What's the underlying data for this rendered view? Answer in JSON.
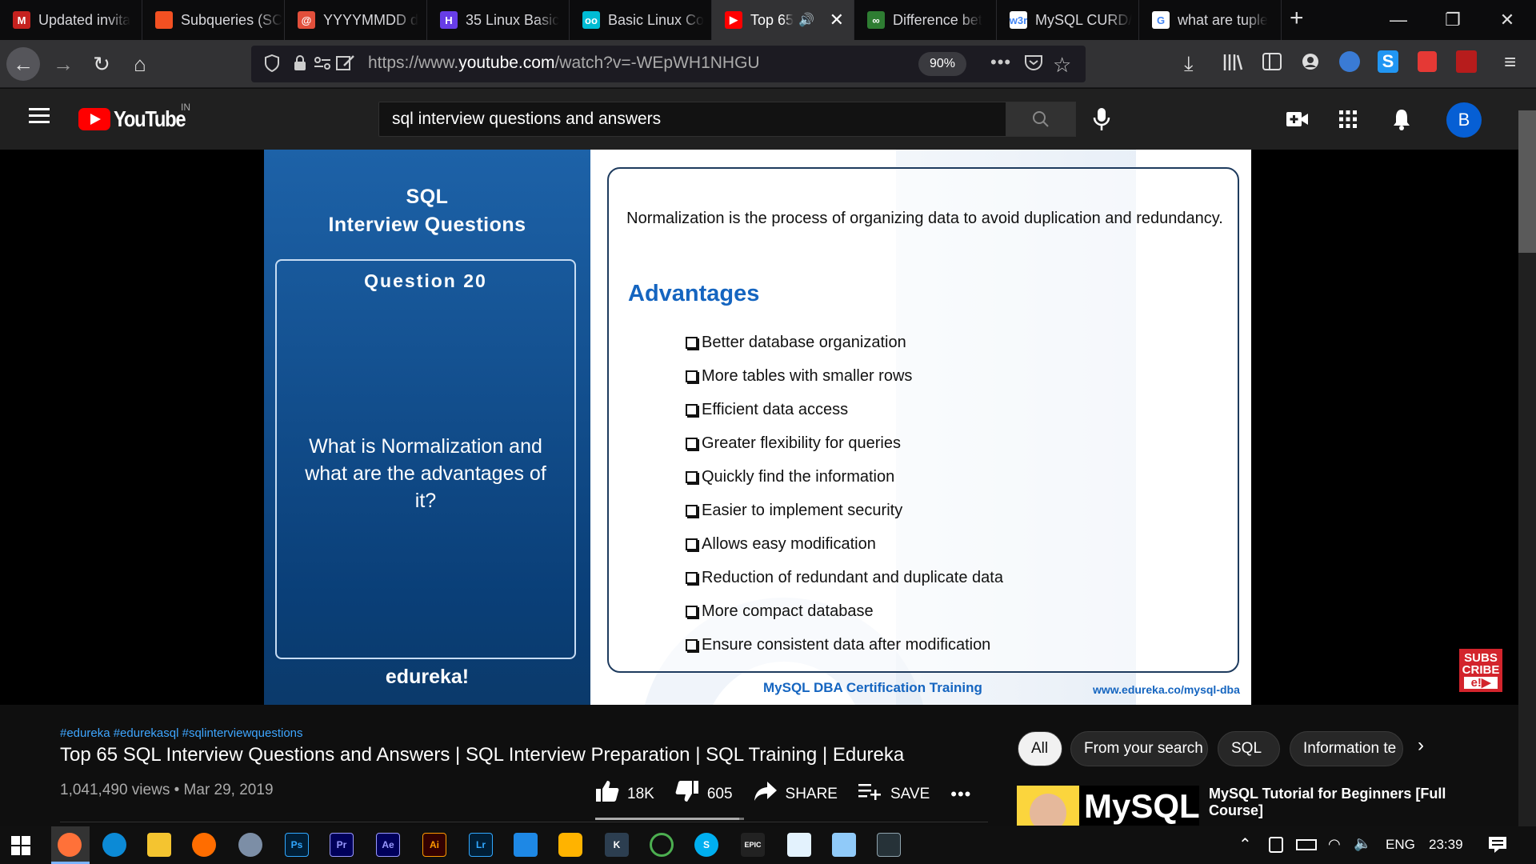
{
  "browser": {
    "tabs": [
      {
        "title": "Updated invita",
        "favicon": "gmail-icon",
        "color": "#c5221f",
        "glyph": "M"
      },
      {
        "title": "Subqueries (SC",
        "favicon": "microsoft-icon",
        "color": "#f25022",
        "glyph": ""
      },
      {
        "title": "YYYYMMDD d",
        "favicon": "red-circle-icon",
        "color": "#e24f3b",
        "glyph": "@"
      },
      {
        "title": "35 Linux Basic",
        "favicon": "hostinger-icon",
        "color": "#673de6",
        "glyph": "H"
      },
      {
        "title": "Basic Linux Co",
        "favicon": "goggles-icon",
        "color": "#00bcd4",
        "glyph": "oo"
      },
      {
        "title": "Top 65",
        "favicon": "youtube-icon",
        "color": "#ff0000",
        "glyph": "▶",
        "active": true,
        "audio": "🔊",
        "close": "✕"
      },
      {
        "title": "Difference bet",
        "favicon": "link-icon",
        "color": "#2e7d32",
        "glyph": "∞"
      },
      {
        "title": "MySQL CURD/",
        "favicon": "w3r-icon",
        "color": "#ffffff",
        "glyph": "w3r"
      },
      {
        "title": "what are tuple",
        "favicon": "google-icon",
        "color": "#ffffff",
        "glyph": "G"
      }
    ],
    "new_tab": "+",
    "window_controls": {
      "minimize": "—",
      "restore": "❐",
      "close": "✕"
    },
    "nav": {
      "back": "←",
      "forward": "→",
      "reload": "↻",
      "home": "⌂"
    },
    "url_prefix": "https://www.",
    "url_host": "youtube.com",
    "url_path": "/watch?v=-WEpWH1NHGU",
    "zoom": "90%",
    "page_actions": "•••"
  },
  "youtube": {
    "logo_text": "YouTube",
    "country": "IN",
    "search_value": "sql interview questions and answers",
    "avatar_letter": "B"
  },
  "slide": {
    "title_line1": "SQL",
    "title_line2": "Interview Questions",
    "question_number": "Question 20",
    "question_text": "What is Normalization and what are the advantages of it?",
    "brand": "edureka!",
    "definition": "Normalization is the process of organizing data to avoid duplication and redundancy.",
    "advantages_title": "Advantages",
    "advantages": [
      "Better database organization",
      "More tables with smaller rows",
      "Efficient data access",
      "Greater flexibility for queries",
      "Quickly find the information",
      "Easier to implement security",
      "Allows easy modification",
      "Reduction of redundant and duplicate data",
      "More compact database",
      "Ensure consistent data after modification"
    ],
    "footer_course": "MySQL DBA Certification Training",
    "footer_url": "www.edureka.co/mysql-dba",
    "subscribe_line1": "SUBS",
    "subscribe_line2": "CRIBE",
    "subscribe_line3": "e!▶"
  },
  "video": {
    "hashtags": "#edureka #edurekasql #sqlinterviewquestions",
    "title": "Top 65 SQL Interview Questions and Answers | SQL Interview Preparation | SQL Training | Edureka",
    "views": "1,041,490 views",
    "date": "Mar 29, 2019",
    "likes": "18K",
    "dislikes": "605",
    "share_label": "SHARE",
    "save_label": "SAVE",
    "more": "•••",
    "like_ratio": 0.968
  },
  "chips": [
    "All",
    "From your search",
    "SQL",
    "Information te"
  ],
  "related": {
    "thumb_text": "MySQL",
    "title": "MySQL Tutorial for Beginners [Full Course]"
  },
  "taskbar": {
    "language": "ENG",
    "time": "23:39"
  }
}
